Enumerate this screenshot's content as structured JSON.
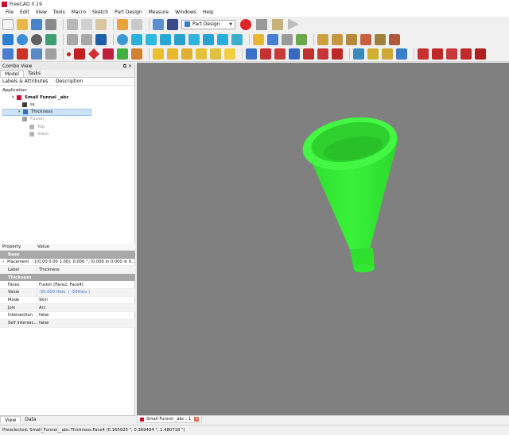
{
  "window": {
    "title": "FreeCAD 0.19"
  },
  "menu": [
    "File",
    "Edit",
    "View",
    "Tools",
    "Macro",
    "Sketch",
    "Part Design",
    "Measure",
    "Windows",
    "Help"
  ],
  "toolbar": {
    "workbench": "Part Design"
  },
  "combo": {
    "title": "Combo View",
    "tabs": [
      "Model",
      "Tasks"
    ],
    "tree_columns": [
      "Labels & Attributes",
      "Description"
    ],
    "application_label": "Application",
    "tree": [
      {
        "label": "Small Funnel _abc",
        "level": 0,
        "icon": "document-icon",
        "selected": false,
        "muted": false
      },
      {
        "label": "ss",
        "level": 1,
        "icon": "spreadsheet-icon",
        "selected": false,
        "muted": false
      },
      {
        "label": "Thickness",
        "level": 1,
        "icon": "thickness-icon",
        "selected": true,
        "muted": false
      },
      {
        "label": "Fusion",
        "level": 2,
        "icon": "fusion-icon",
        "selected": false,
        "muted": true
      },
      {
        "label": "Top",
        "level": 3,
        "icon": "solid-icon",
        "selected": false,
        "muted": true
      },
      {
        "label": "Stem",
        "level": 3,
        "icon": "solid-icon",
        "selected": false,
        "muted": true
      }
    ],
    "properties": {
      "columns": [
        "Property",
        "Value"
      ],
      "groups": [
        {
          "name": "Base",
          "rows": [
            {
              "key": "Placement",
              "value": "[(0.00 0.00 1.00); 0.000 °; (0.000 in  0.000 in  0..."
            },
            {
              "key": "Label",
              "value": "Thickness"
            }
          ]
        },
        {
          "name": "Thickness",
          "rows": [
            {
              "key": "Faces",
              "value": "Fusion [Face2, Face4]"
            },
            {
              "key": "Value",
              "value": "-50.000 thou",
              "extra": "( -50thou )"
            },
            {
              "key": "Mode",
              "value": "Skin"
            },
            {
              "key": "Join",
              "value": "Arc"
            },
            {
              "key": "Intersection",
              "value": "false"
            },
            {
              "key": "Self Intersec...",
              "value": "false"
            }
          ]
        }
      ]
    },
    "bottom_tabs": [
      "View",
      "Data"
    ]
  },
  "viewport": {
    "background": "#808080",
    "model_color": "#33ee33"
  },
  "doc_tab": {
    "label": "Small Funnel _abc : 1"
  },
  "status": {
    "text": "Preselected: Small_Funnel__abc.Thickness.Face4 (0.165925 \", 0.369484 \", 1.480718 \")"
  }
}
